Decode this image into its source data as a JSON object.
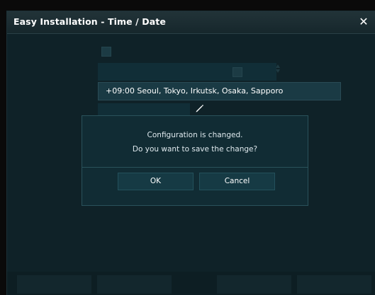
{
  "window": {
    "title": "Easy Installation - Time / Date"
  },
  "form": {
    "tz_value": "+09:00 Seoul, Tokyo, Irkutsk, Osaka, Sapporo"
  },
  "dialog": {
    "line1": "Configuration is changed.",
    "line2": "Do you want to save the change?",
    "ok_label": "OK",
    "cancel_label": "Cancel"
  },
  "colors": {
    "panel": "#0f2228",
    "dialog_bg": "#112c34",
    "dialog_border": "#2a525b",
    "button": "#163a44",
    "text": "#dfe9ee"
  }
}
